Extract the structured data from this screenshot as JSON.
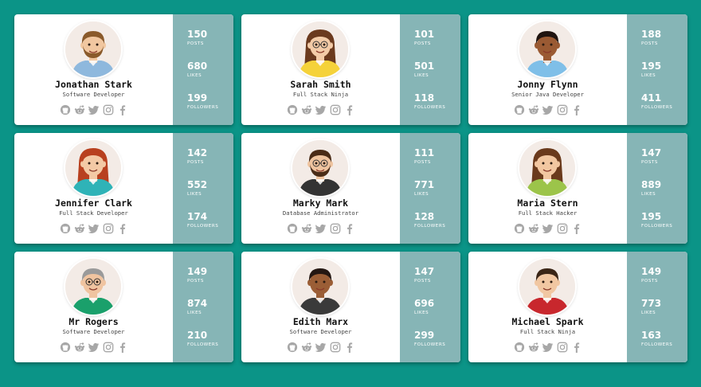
{
  "icons": [
    "github-icon",
    "reddit-icon",
    "twitter-icon",
    "instagram-icon",
    "facebook-icon"
  ],
  "colors": {
    "background": "#0b9487",
    "stats_panel": "#86b5b6",
    "card": "#ffffff",
    "icon_gray": "#a7a7a7"
  },
  "stat_labels": {
    "posts": "POSTS",
    "likes": "LIKES",
    "followers": "FOLLOWERS"
  },
  "cards": [
    {
      "name": "Jonathan Stark",
      "role": "Software Developer",
      "posts": "150",
      "likes": "680",
      "followers": "199",
      "avatar": {
        "skin": "#f1c7a0",
        "hair": "#8a5a2b",
        "shirt": "#8eb8dd",
        "beard": true,
        "glasses": false,
        "long_hair": false
      }
    },
    {
      "name": "Sarah Smith",
      "role": "Full Stack Ninja",
      "posts": "101",
      "likes": "501",
      "followers": "118",
      "avatar": {
        "skin": "#f3cba7",
        "hair": "#6b3a1e",
        "shirt": "#f5d23a",
        "beard": false,
        "glasses": true,
        "long_hair": true
      }
    },
    {
      "name": "Jonny Flynn",
      "role": "Senior Java Developer",
      "posts": "188",
      "likes": "195",
      "followers": "411",
      "avatar": {
        "skin": "#9a5a33",
        "hair": "#1f1410",
        "shirt": "#7fbfe8",
        "beard": false,
        "glasses": false,
        "long_hair": false
      }
    },
    {
      "name": "Jennifer Clark",
      "role": "Full Stack Developer",
      "posts": "142",
      "likes": "552",
      "followers": "174",
      "avatar": {
        "skin": "#f3c9a5",
        "hair": "#b8401f",
        "shirt": "#2fb3b7",
        "beard": false,
        "glasses": false,
        "long_hair": true
      }
    },
    {
      "name": "Marky Mark",
      "role": "Database Administrator",
      "posts": "111",
      "likes": "771",
      "followers": "128",
      "avatar": {
        "skin": "#efc49f",
        "hair": "#4a2c17",
        "shirt": "#333333",
        "beard": true,
        "glasses": true,
        "long_hair": false
      }
    },
    {
      "name": "Maria Stern",
      "role": "Full Stack Hacker",
      "posts": "147",
      "likes": "889",
      "followers": "195",
      "avatar": {
        "skin": "#f2c7a1",
        "hair": "#6a3a1c",
        "shirt": "#9cc44a",
        "beard": false,
        "glasses": false,
        "long_hair": true
      }
    },
    {
      "name": "Mr Rogers",
      "role": "Software Developer",
      "posts": "149",
      "likes": "874",
      "followers": "210",
      "avatar": {
        "skin": "#f0c4a0",
        "hair": "#9a9a9a",
        "shirt": "#1aa06b",
        "beard": false,
        "glasses": true,
        "long_hair": false
      }
    },
    {
      "name": "Edith Marx",
      "role": "Software Developer",
      "posts": "147",
      "likes": "696",
      "followers": "299",
      "avatar": {
        "skin": "#9b5e36",
        "hair": "#241712",
        "shirt": "#3a3a3a",
        "beard": false,
        "glasses": false,
        "long_hair": false
      }
    },
    {
      "name": "Michael Spark",
      "role": "Full Stack Ninja",
      "posts": "149",
      "likes": "773",
      "followers": "163",
      "avatar": {
        "skin": "#f1c7a2",
        "hair": "#3a2516",
        "shirt": "#c8272d",
        "beard": false,
        "glasses": false,
        "long_hair": false
      }
    }
  ]
}
